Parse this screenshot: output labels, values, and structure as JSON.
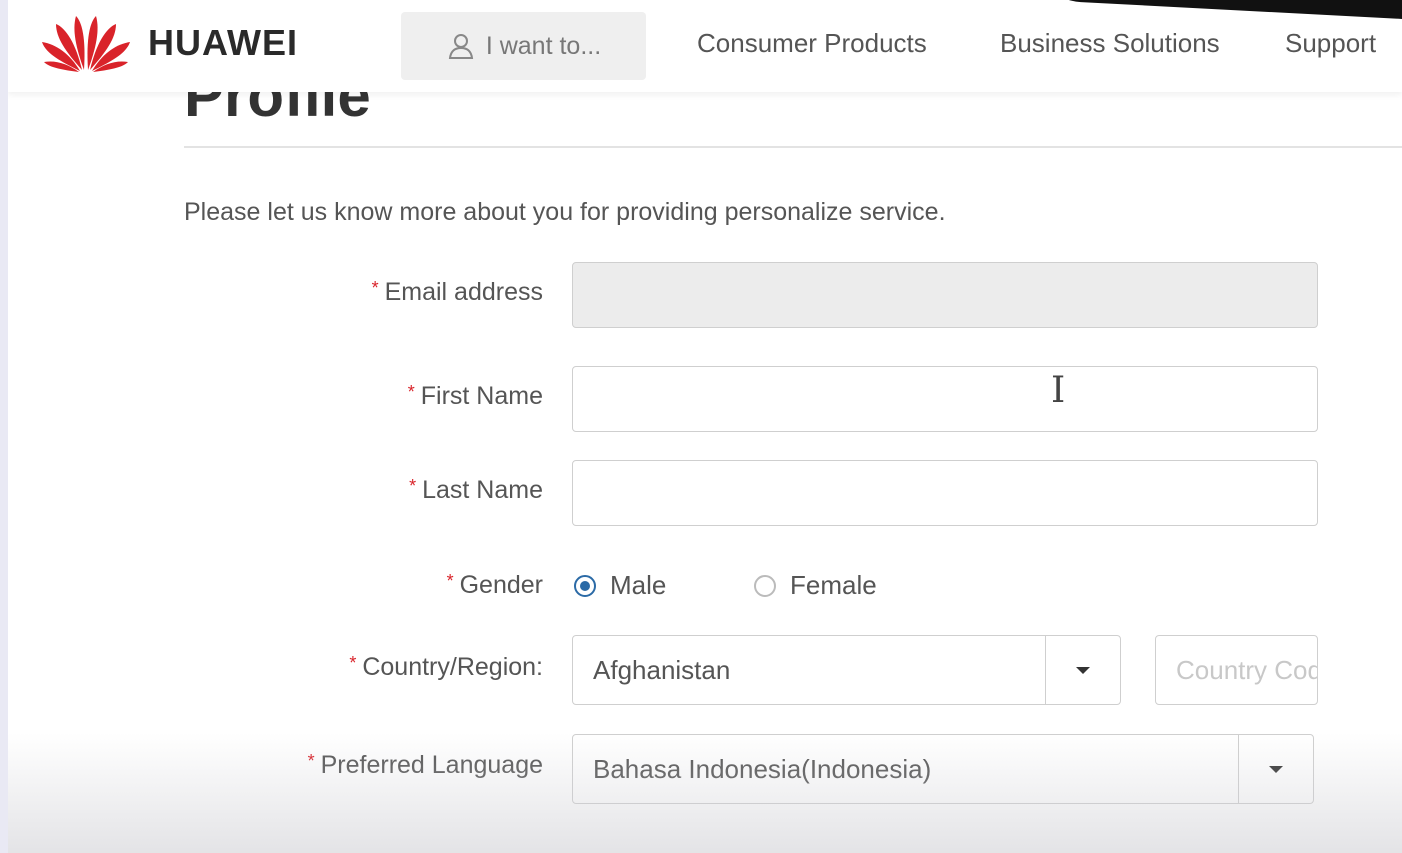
{
  "header": {
    "brand": "HUAWEI",
    "want_to": "I want to...",
    "nav": [
      "Consumer Products",
      "Business Solutions",
      "Support"
    ]
  },
  "form": {
    "intro": "Please let us know more about you for providing personalize service.",
    "required_mark": "*",
    "labels": {
      "email": "Email address",
      "first_name": "First Name",
      "last_name": "Last Name",
      "gender": "Gender",
      "country": "Country/Region:",
      "language": "Preferred Language"
    },
    "gender_options": [
      "Male",
      "Female"
    ],
    "gender_selected": "Male",
    "country_value": "Afghanistan",
    "country_code_placeholder": "Country Code",
    "language_value": "Bahasa Indonesia(Indonesia)"
  },
  "colors": {
    "brand_red": "#d9232a",
    "radio_blue": "#2b6aa6"
  }
}
